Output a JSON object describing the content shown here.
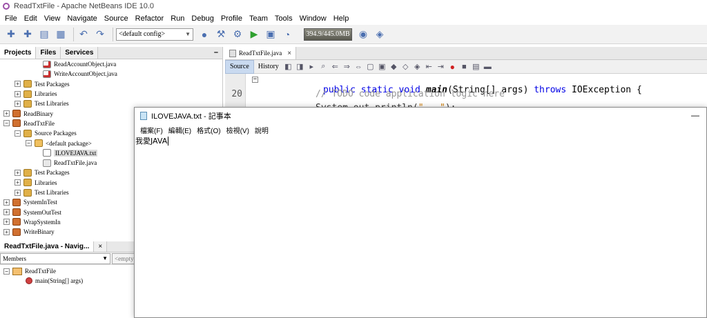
{
  "window": {
    "title": "ReadTxtFile - Apache NetBeans IDE 10.0"
  },
  "menubar": [
    "File",
    "Edit",
    "View",
    "Navigate",
    "Source",
    "Refactor",
    "Run",
    "Debug",
    "Profile",
    "Team",
    "Tools",
    "Window",
    "Help"
  ],
  "toolbar": {
    "config_value": "<default config>",
    "memory": "394.9/445.0MB"
  },
  "projects_panel": {
    "tabs": [
      "Projects",
      "Files",
      "Services"
    ],
    "minimize": "–",
    "tree": [
      {
        "label": "ReadAccountObject.java",
        "icon": "java-file-icon"
      },
      {
        "label": "WriteAccountObject.java",
        "icon": "java-file-icon"
      },
      {
        "label": "Test Packages",
        "icon": "folder-icon"
      },
      {
        "label": "Libraries",
        "icon": "folder-icon"
      },
      {
        "label": "Test Libraries",
        "icon": "folder-icon"
      },
      {
        "label": "ReadBinary",
        "icon": "project-icon"
      },
      {
        "label": "ReadTxtFile",
        "icon": "project-icon"
      },
      {
        "label": "Source Packages",
        "icon": "folder-icon"
      },
      {
        "label": "<default package>",
        "icon": "package-icon"
      },
      {
        "label": "ILOVEJAVA.txt",
        "icon": "text-file-icon"
      },
      {
        "label": "ReadTxtFile.java",
        "icon": "java-file-icon"
      },
      {
        "label": "Test Packages",
        "icon": "folder-icon"
      },
      {
        "label": "Libraries",
        "icon": "folder-icon"
      },
      {
        "label": "Test Libraries",
        "icon": "folder-icon"
      },
      {
        "label": "SystemInTest",
        "icon": "project-icon"
      },
      {
        "label": "SystemOutTest",
        "icon": "project-icon"
      },
      {
        "label": "WrapSystemIn",
        "icon": "project-icon"
      },
      {
        "label": "WriteBinary",
        "icon": "project-icon"
      }
    ]
  },
  "navigator_panel": {
    "tab": "ReadTxtFile.java - Navig...",
    "close": "×",
    "members_label": "Members",
    "empty_label": "<empty>",
    "tree": [
      {
        "label": "ReadTxtFile",
        "icon": "class-icon"
      },
      {
        "label": "main(String[] args)",
        "icon": "method-icon"
      }
    ]
  },
  "editor": {
    "tab_label": "ReadTxtFile.java",
    "tab_close": "×",
    "modes": [
      "Source",
      "History"
    ],
    "line_numbers": [
      "20"
    ],
    "code": {
      "line1": {
        "kw1": "public static void ",
        "fn": "main",
        "rest1": "(String[] args) ",
        "kw2": "throws",
        "rest2": " IOException {"
      },
      "line2": "// TODO code application logic here"
    }
  },
  "notepad": {
    "title": "ILOVEJAVA.txt - 記事本",
    "menus": [
      "檔案(F)",
      "編輯(E)",
      "格式(O)",
      "檢視(V)",
      "說明"
    ],
    "minimize": "—",
    "content": "我愛JAVA"
  }
}
